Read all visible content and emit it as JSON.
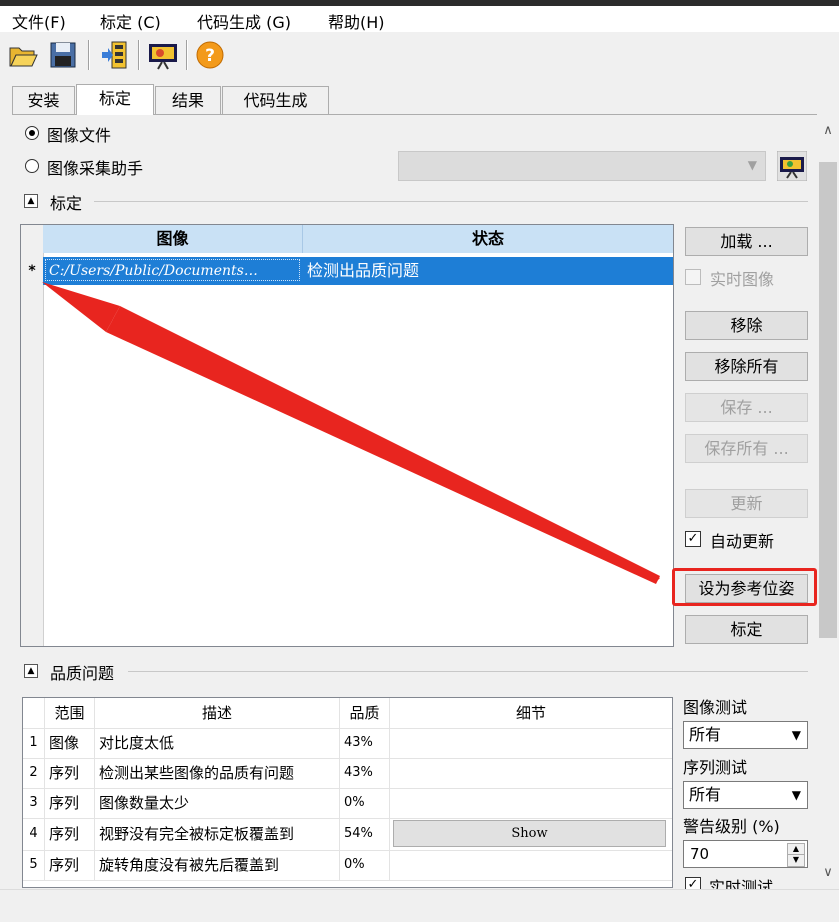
{
  "menu": {
    "file": "文件(F)",
    "calibrate": "标定 (C)",
    "codegen": "代码生成 (G)",
    "help": "帮助(H)"
  },
  "toolbar": {
    "open_icon": "folder-open-icon",
    "save_icon": "save-icon",
    "load_icon": "load-images-icon",
    "capture_icon": "camera-capture-icon",
    "help_icon": "help-icon"
  },
  "tabs": [
    "安装",
    "标定",
    "结果",
    "代码生成"
  ],
  "source": {
    "image_file": "图像文件",
    "acq_assistant": "图像采集助手"
  },
  "calibration": {
    "section_title": "标定",
    "col_image": "图像",
    "col_status": "状态",
    "rows": [
      {
        "marker": "*",
        "image": "C:/Users/Public/Documents…",
        "status": "检测出品质问题"
      }
    ]
  },
  "buttons": {
    "load": "加载 ...",
    "live_image": "实时图像",
    "remove": "移除",
    "remove_all": "移除所有",
    "save": "保存 ...",
    "save_all": "保存所有 ...",
    "update": "更新",
    "auto_update": "自动更新",
    "set_reference_pose": "设为参考位姿",
    "calibrate": "标定"
  },
  "quality": {
    "section_title": "品质问题",
    "headers": [
      "范围",
      "描述",
      "品质",
      "细节"
    ],
    "rows": [
      {
        "num": "1",
        "scope": "图像",
        "desc": "对比度太低",
        "quality": "43%",
        "detail": ""
      },
      {
        "num": "2",
        "scope": "序列",
        "desc": "检测出某些图像的品质有问题",
        "quality": "43%",
        "detail": ""
      },
      {
        "num": "3",
        "scope": "序列",
        "desc": "图像数量太少",
        "quality": "0%",
        "detail": ""
      },
      {
        "num": "4",
        "scope": "序列",
        "desc": "视野没有完全被标定板覆盖到",
        "quality": "54%",
        "detail": "Show"
      },
      {
        "num": "5",
        "scope": "序列",
        "desc": "旋转角度没有被先后覆盖到",
        "quality": "0%",
        "detail": ""
      }
    ],
    "image_test_label": "图像测试",
    "image_test_value": "所有",
    "sequence_test_label": "序列测试",
    "sequence_test_value": "所有",
    "warning_level_label": "警告级别 (%)",
    "warning_level_value": "70",
    "live_test_label": "实时测试"
  },
  "colors": {
    "selection": "#1e7ed6",
    "header_bg": "#c9e1f5",
    "annotation": "#e8251f"
  }
}
